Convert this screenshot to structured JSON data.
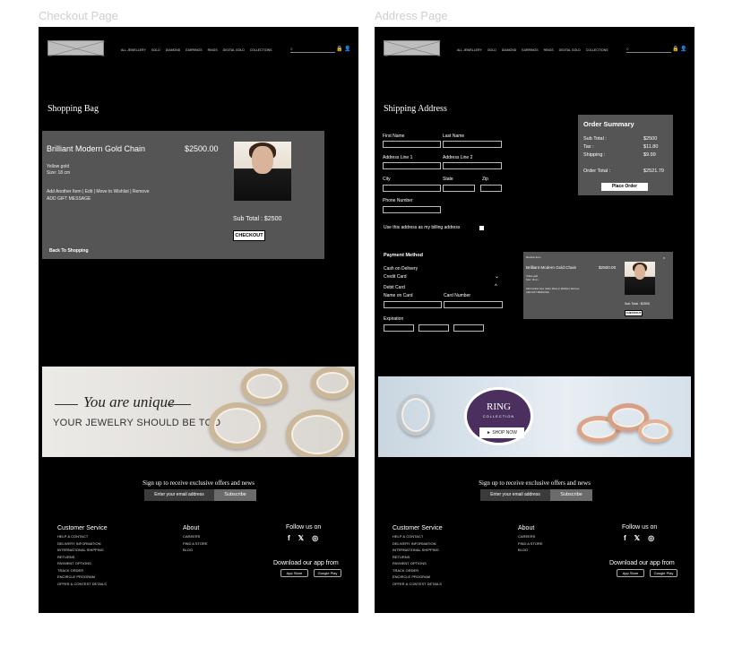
{
  "frames": {
    "checkout_title": "Checkout Page",
    "address_title": "Address Page"
  },
  "header": {
    "nav": [
      "ALL JEWELLERY",
      "GOLD",
      "DIAMOND",
      "EARRINGS",
      "RINGS",
      "DIGITAL GOLD",
      "COLLECTIONS"
    ],
    "search_glyph": "⌕",
    "icons": "🔒 👤"
  },
  "checkout": {
    "heading": "Shopping Bag",
    "product_name": "Brilliant Modern Gold Chain",
    "price": "$2500.00",
    "meta1": "Yellow gold",
    "meta2": "Size: 18 cm",
    "actions": "Add Another Item | Edit | Move to Wishlist | Remove",
    "gift": "ADD GIFT MESSAGE",
    "subtotal": "Sub Total :  $2500",
    "checkout_btn": "CHECKOUT",
    "back": "Back To Shopping"
  },
  "banner1": {
    "script": "You are unique",
    "sub": "YOUR JEWELRY SHOULD BE TOO"
  },
  "banner2": {
    "title": "RING",
    "sub": "COLLECTION",
    "shop": "► SHOP NOW"
  },
  "newsletter": {
    "title": "Sign up to receive exclusive offers and news",
    "placeholder": "Enter your email address",
    "button": "Subscribe"
  },
  "footer": {
    "cs_title": "Customer Service",
    "cs_links": [
      "HELP & CONTACT",
      "DELIVERY INFORMATION",
      "INTERNATIONAL SHIPPING",
      "RETURNS",
      "PAYMENT OPTIONS",
      "TRACK ORDER",
      "ENCIRCLE PROGRAM",
      "OFFER & CONTEST DETAILS"
    ],
    "about_title": "About",
    "about_links": [
      "CAREERS",
      "FIND A STORE",
      "BLOG"
    ],
    "follow": "Follow us on",
    "social": [
      "f",
      "𝕏",
      "◎"
    ],
    "download": "Download our app from",
    "app_store": "App Store",
    "google_play": "Google Play"
  },
  "address": {
    "heading": "Shipping Address",
    "first_name": "First Name",
    "last_name": "Last Name",
    "line1": "Address Line 1",
    "line2": "Address Line 2",
    "city": "City",
    "state": "State",
    "zip": "Zip",
    "phone": "Phone Number",
    "billing_same": "Use this address as my billing address",
    "payment_title": "Payment Method",
    "cod": "Cash on Delivery",
    "credit": "Credit Card",
    "debit": "Debit Card",
    "name_on_card": "Name on Card",
    "card_number": "Card Number",
    "expiration": "Expiration"
  },
  "summary": {
    "title": "Order Summary",
    "subtotal_label": "Sub Total :",
    "subtotal_value": "$2500",
    "tax_label": "Tax :",
    "tax_value": "$11.80",
    "shipping_label": "Shipping :",
    "shipping_value": "$9.99",
    "total_label": "Order Total :",
    "total_value": "$2521.79",
    "place_order": "Place Order"
  },
  "mini_cart": {
    "review": "Review Item",
    "close": "x",
    "product_name": "Brilliant Modern Gold Chain",
    "price": "$2500.00",
    "meta1": "Yellow gold",
    "meta2": "Size: 18 cm",
    "actions": "Add Another Item | Edit | Move to Wishlist | Remove",
    "gift": "ADD GIFT MESSAGE",
    "subtotal": "Sub Total :  $2500",
    "checkout_btn": "CHECKOUT"
  },
  "colors": {
    "frame_bg": "#000000",
    "card_bg": "#555555",
    "frame_title": "#cfcfcf"
  }
}
